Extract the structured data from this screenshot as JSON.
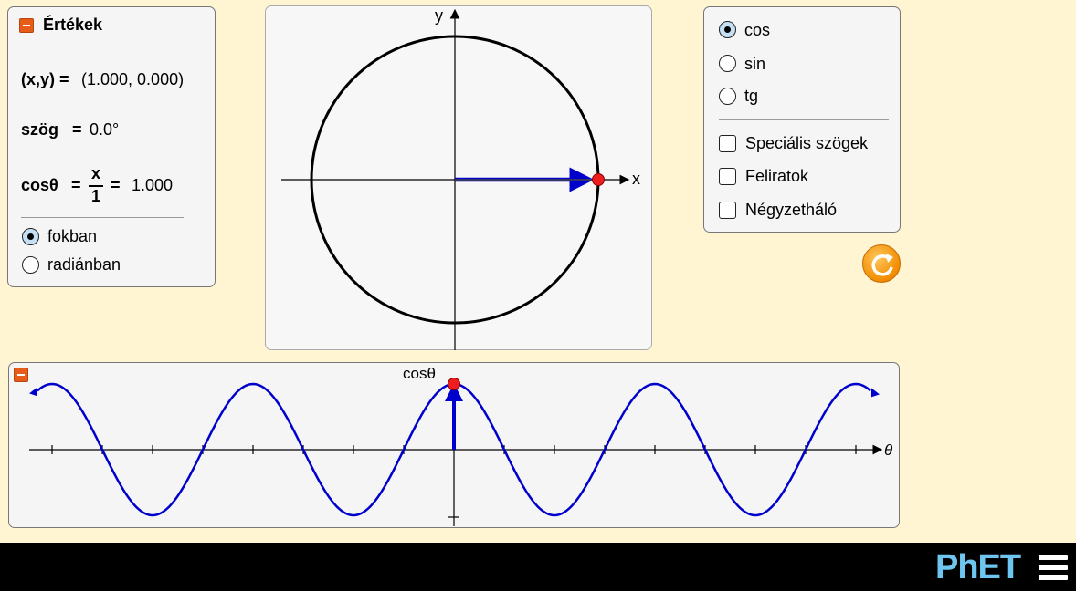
{
  "values_panel": {
    "title": "Értékek",
    "xy_label": "(x,y) =",
    "xy_value": "(1.000, 0.000)",
    "angle_label": "szög",
    "angle_equals": "=",
    "angle_value": "0.0°",
    "cos_label": "cosθ",
    "cos_equals": "=",
    "frac_num": "x",
    "frac_den": "1",
    "cos_equals2": "=",
    "cos_value": "1.000",
    "units": [
      {
        "label": "fokban",
        "checked": true
      },
      {
        "label": "radiánban",
        "checked": false
      }
    ]
  },
  "unit_circle": {
    "x_axis_label": "x",
    "y_axis_label": "y",
    "angle_deg": 0
  },
  "function_panel": {
    "functions": [
      {
        "label": "cos",
        "checked": true
      },
      {
        "label": "sin",
        "checked": false
      },
      {
        "label": "tg",
        "checked": false
      }
    ],
    "options": [
      {
        "label": "Speciális szögek",
        "checked": false
      },
      {
        "label": "Feliratok",
        "checked": false
      },
      {
        "label": "Négyzetháló",
        "checked": false
      }
    ]
  },
  "graph_panel": {
    "y_label": "cosθ",
    "x_label": "θ",
    "function": "cos",
    "current_value": 1.0
  },
  "navbar": {
    "phet_logo": "PhET"
  },
  "colors": {
    "background": "#fff5d2",
    "curve": "#0000cc",
    "point": "#ee1c1c",
    "accent_orange": "#e85c1a"
  }
}
